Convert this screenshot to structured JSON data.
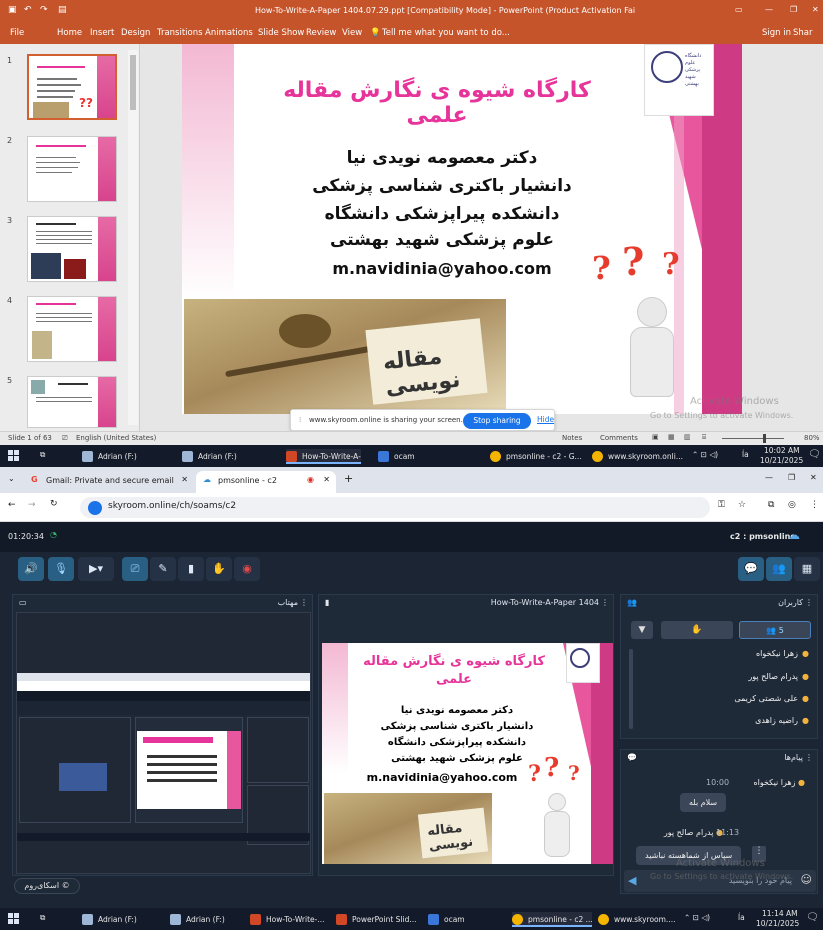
{
  "powerpoint": {
    "window_title": "How-To-Write-A-Paper 1404.07.29.ppt [Compatibility Mode] - PowerPoint (Product Activation Failed)",
    "ribbon_tabs": [
      "File",
      "Home",
      "Insert",
      "Design",
      "Transitions",
      "Animations",
      "Slide Show",
      "Review",
      "View"
    ],
    "tell_me": "Tell me what you want to do...",
    "sign_in": "Sign in",
    "share": "Shar",
    "thumb_numbers": [
      "1",
      "2",
      "3",
      "4",
      "5"
    ],
    "status_slide": "Slide 1 of 63",
    "status_lang": "English (United States)",
    "status_notes": "Notes",
    "status_comments": "Comments",
    "zoom": "80%"
  },
  "slide": {
    "title": "کارگاه شیوه ی نگارش مقاله علمی",
    "author": "دکتر معصومه نویدی نیا",
    "position": "دانشیار باکتری شناسی پزشکی",
    "faculty": "دانشکده پیراپزشکی دانشگاه",
    "university": "علوم پزشکی شهید بهشتی",
    "email": "m.navidinia@yahoo.com",
    "photo_caption": "مقاله نویسی",
    "logo_caption": "دانشگاه علوم پزشکی شهید بهشتی"
  },
  "share_bar": {
    "message": "www.skyroom.online is sharing your screen.",
    "stop_label": "Stop sharing",
    "hide_label": "Hide"
  },
  "activate_watermark": {
    "line1": "Activate Windows",
    "line2": "Go to Settings to activate Windows."
  },
  "taskbar_top": {
    "items": [
      "Adrian (F:)",
      "Adrian (F:)",
      "How-To-Write-A-P...",
      "ocam",
      "pmsonline - c2 - G...",
      "www.skyroom.onli..."
    ],
    "lang": "ĺa",
    "time": "10:02 AM",
    "date": "10/21/2025"
  },
  "chrome": {
    "tab1": "Gmail: Private and secure email",
    "tab2": "pmsonline - c2",
    "url": "skyroom.online/ch/soams/c2"
  },
  "skyroom": {
    "timer": "01:20:34",
    "room_name": "c2 : pmsonline",
    "webcam_panel_title": "مهتاب",
    "presentation_title": "How-To-Write-A-Paper 1404",
    "users_panel_title": "کاربران",
    "users_count": "5",
    "users": [
      "زهرا نیکخواه",
      "پدرام صالح پور",
      "علی شصتی کریمی",
      "راضیه زاهدی"
    ],
    "messages_panel_title": "پیام‌ها",
    "messages": [
      {
        "sender": "زهرا نیکخواه",
        "time": "10:00",
        "text": "سلام بله"
      },
      {
        "sender": "پدرام صالح پور",
        "time": "11:13",
        "text": "سپاس از شماهسته نباشید"
      }
    ],
    "chat_placeholder": "پیام خود را بنویسید",
    "brand": "اسکای‌روم"
  },
  "taskbar_bottom": {
    "items": [
      "Adrian (F:)",
      "Adrian (F:)",
      "How-To-Write-...",
      "PowerPoint Slid...",
      "ocam",
      "pmsonline - c2 ...",
      "www.skyroom...."
    ],
    "lang": "ĺa",
    "time": "11:14 AM",
    "date": "10/21/2025"
  }
}
